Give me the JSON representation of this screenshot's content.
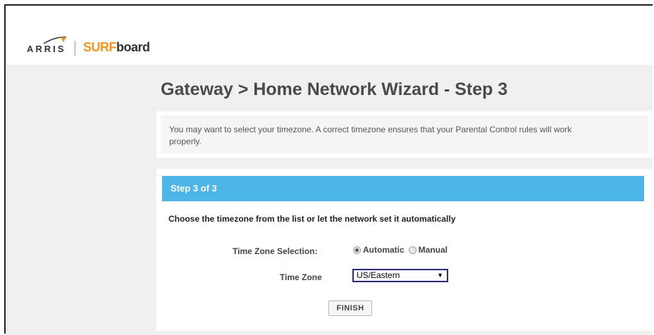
{
  "brand": {
    "arris": "ARRIS",
    "surf": "SURF",
    "board": "board",
    "accent_color": "#f7941d"
  },
  "page": {
    "title": "Gateway > Home Network Wizard - Step 3"
  },
  "info": {
    "text": "You may want to select your timezone. A correct timezone ensures that your Parental Control rules will work properly."
  },
  "step": {
    "header": "Step 3 of 3",
    "header_color": "#4db6e8",
    "instruction": "Choose the timezone from the list or let the network set it automatically",
    "tz_selection_label": "Time Zone Selection:",
    "radio_automatic": "Automatic",
    "radio_manual": "Manual",
    "selected_mode": "Automatic",
    "tz_label": "Time Zone",
    "tz_value": "US/Eastern",
    "finish_label": "FINISH"
  }
}
